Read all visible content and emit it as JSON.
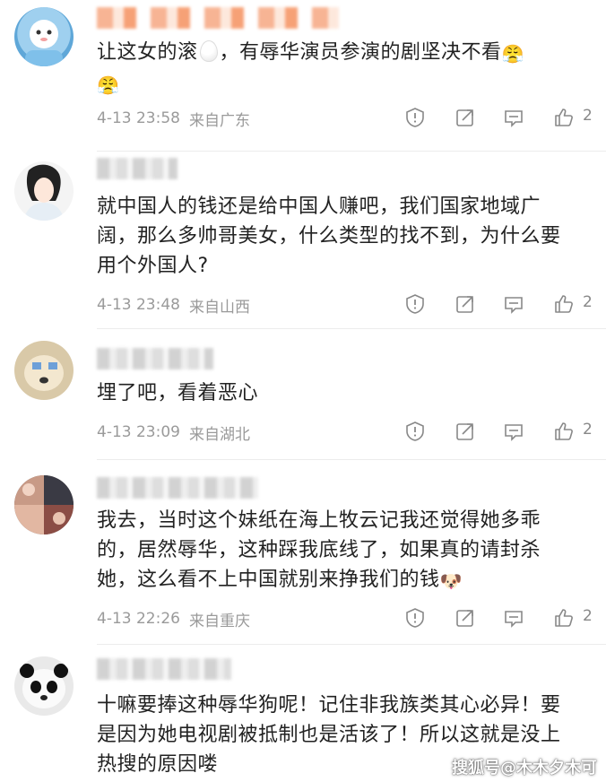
{
  "comments": [
    {
      "text": "让这女的滚",
      "text_after_egg": "，有辱华演员参演的剧坚决不看",
      "emoji": "😤",
      "emoji2": "😤",
      "time": "4-13 23:58",
      "location": "来自广东",
      "likes": "2"
    },
    {
      "text": "就中国人的钱还是给中国人赚吧，我们国家地域广阔，那么多帅哥美女，什么类型的找不到，为什么要用个外国人?",
      "time": "4-13 23:48",
      "location": "来自山西",
      "likes": "2"
    },
    {
      "text": "埋了吧，看着恶心",
      "time": "4-13 23:09",
      "location": "来自湖北",
      "likes": "2"
    },
    {
      "text": "我去，当时这个妹纸在海上牧云记我还觉得她多乖的，居然辱华，这种踩我底线了，如果真的请封杀她，这么看不上中国就别来挣我们的钱",
      "emoji": "🐶",
      "time": "4-13 22:26",
      "location": "来自重庆",
      "likes": "2"
    },
    {
      "text": "十嘛要捧这种辱华狗呢！记住非我族类其心必异！要是因为她电视剧被抵制也是活该了！所以这就是没上热搜的原因喽"
    }
  ],
  "watermark": "搜狐号@木木夕木可",
  "icons": {
    "report": "report-icon",
    "share": "share-icon",
    "comment": "comment-icon",
    "like": "like-icon"
  }
}
